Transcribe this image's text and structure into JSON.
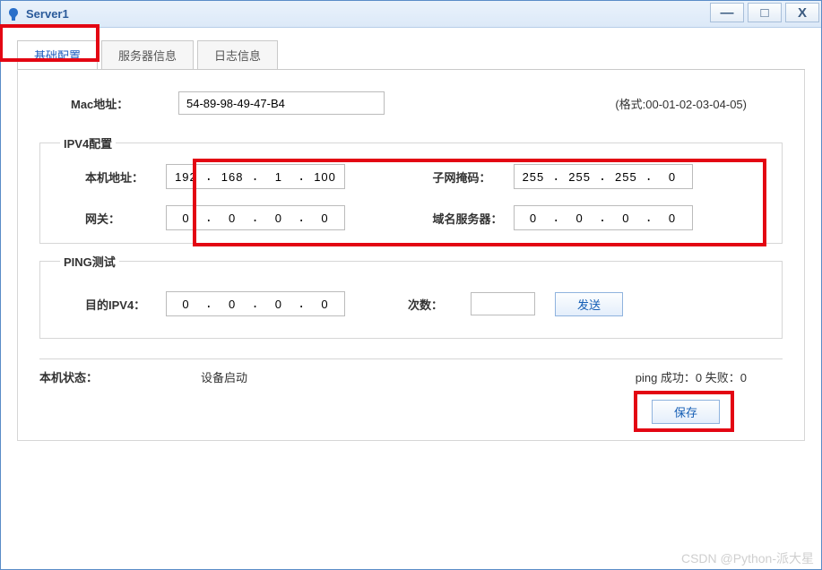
{
  "window": {
    "title": "Server1"
  },
  "tabs": {
    "t0": "基础配置",
    "t1": "服务器信息",
    "t2": "日志信息"
  },
  "mac": {
    "label": "Mac地址：",
    "value": "54-89-98-49-47-B4",
    "format": "(格式:00-01-02-03-04-05)"
  },
  "ipv4": {
    "legend": "IPV4配置",
    "host_label": "本机地址：",
    "host": {
      "a": "192",
      "b": "168",
      "c": "1",
      "d": "100"
    },
    "mask_label": "子网掩码：",
    "mask": {
      "a": "255",
      "b": "255",
      "c": "255",
      "d": "0"
    },
    "gw_label": "网关：",
    "gw": {
      "a": "0",
      "b": "0",
      "c": "0",
      "d": "0"
    },
    "dns_label": "域名服务器：",
    "dns": {
      "a": "0",
      "b": "0",
      "c": "0",
      "d": "0"
    }
  },
  "ping": {
    "legend": "PING测试",
    "target_label": "目的IPV4：",
    "target": {
      "a": "0",
      "b": "0",
      "c": "0",
      "d": "0"
    },
    "count_label": "次数：",
    "count": "",
    "send": "发送"
  },
  "status": {
    "host_label": "本机状态：",
    "host_value": "设备启动",
    "ping_result": "ping 成功：0 失败：0"
  },
  "buttons": {
    "save": "保存"
  },
  "watermark": "CSDN @Python-派大星"
}
